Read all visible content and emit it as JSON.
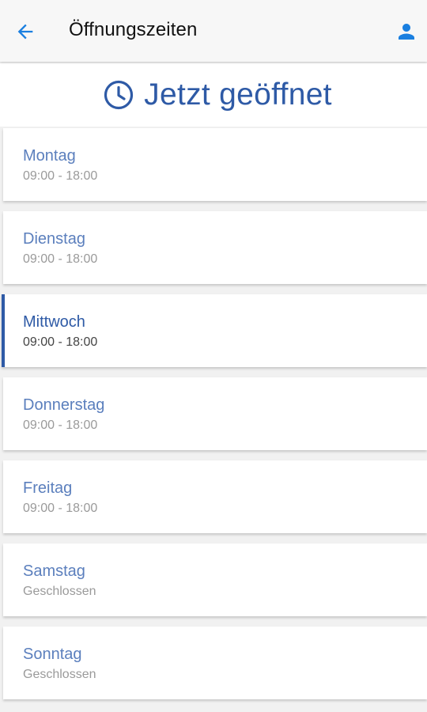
{
  "appbar": {
    "title": "Öffnungszeiten",
    "back_icon": "arrow-left-icon",
    "profile_icon": "person-icon"
  },
  "status": {
    "icon": "clock-icon",
    "text": "Jetzt geöffnet"
  },
  "days": [
    {
      "name": "Montag",
      "hours": "09:00 - 18:00"
    },
    {
      "name": "Dienstag",
      "hours": "09:00 - 18:00"
    },
    {
      "name": "Mittwoch",
      "hours": "09:00 - 18:00",
      "active": true
    },
    {
      "name": "Donnerstag",
      "hours": "09:00 - 18:00"
    },
    {
      "name": "Freitag",
      "hours": "09:00 - 18:00"
    },
    {
      "name": "Samstag",
      "hours": "Geschlossen"
    },
    {
      "name": "Sonntag",
      "hours": "Geschlossen"
    }
  ],
  "colors": {
    "accent": "#2e5aa6",
    "icon_blue": "#1a7fe0",
    "inactive_day": "#5b7fbd",
    "muted_text": "#9a9a9a"
  }
}
